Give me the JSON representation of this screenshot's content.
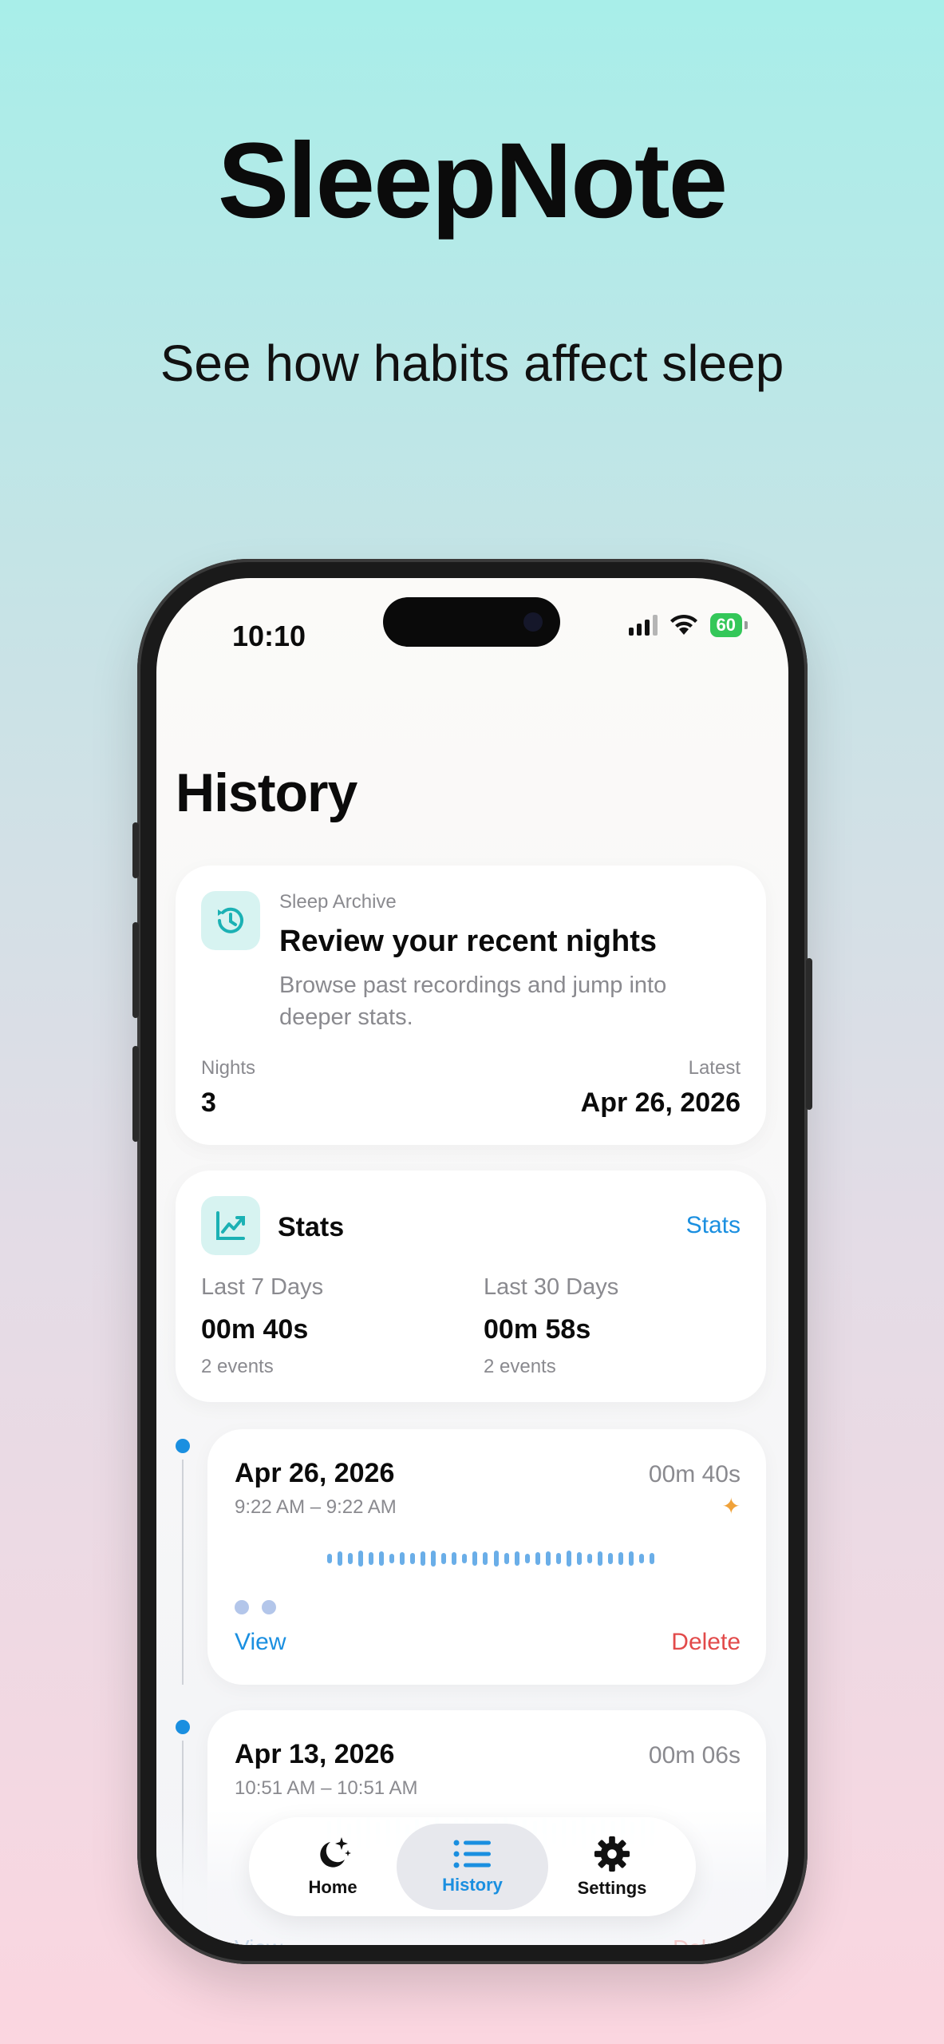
{
  "promo": {
    "title": "SleepNote",
    "subtitle": "See how habits affect sleep"
  },
  "status_bar": {
    "time": "10:10",
    "battery": "60"
  },
  "page": {
    "title": "History"
  },
  "archive_card": {
    "eyebrow": "Sleep Archive",
    "heading": "Review your recent nights",
    "description": "Browse past recordings and jump into deeper stats.",
    "nights_label": "Nights",
    "nights_value": "3",
    "latest_label": "Latest",
    "latest_value": "Apr 26, 2026",
    "icon": "history-clock-icon"
  },
  "stats_card": {
    "title": "Stats",
    "link": "Stats",
    "icon": "chart-line-icon",
    "last7": {
      "label": "Last 7 Days",
      "value": "00m 40s",
      "events": "2 events"
    },
    "last30": {
      "label": "Last 30 Days",
      "value": "00m 58s",
      "events": "2 events"
    }
  },
  "nights": [
    {
      "date": "Apr 26, 2026",
      "range": "9:22 AM – 9:22 AM",
      "duration": "00m 40s",
      "view": "View",
      "delete": "Delete"
    },
    {
      "date": "Apr 13, 2026",
      "range": "10:51 AM – 10:51 AM",
      "duration": "00m 06s",
      "view": "View",
      "delete": "Delete"
    }
  ],
  "tabbar": {
    "home": "Home",
    "history": "History",
    "settings": "Settings",
    "active": "history"
  },
  "colors": {
    "accent": "#1a8fe0",
    "danger": "#e24a4a",
    "battery": "#34c759",
    "teal_tile": "#d7f3f1"
  }
}
